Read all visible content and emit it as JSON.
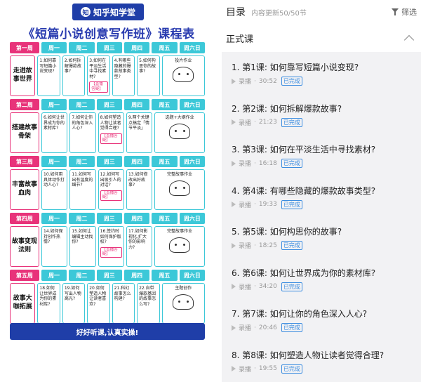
{
  "poster": {
    "brand": "知乎知学堂",
    "title": "《短篇小说创意写作班》课程表",
    "day_headers": [
      "周一",
      "周二",
      "周三",
      "周四",
      "周五",
      "周六日"
    ],
    "weeks": [
      {
        "week_label": "第一周",
        "topic": "走进故事世界",
        "days": [
          "1.如何靠写短篇小说变现?",
          "2.如何拆解爆款故事?",
          "3.如何在平淡生活中寻找素材?",
          "4.有哪些隐藏的爆款故事类型?",
          "5.如何构思你的故事?"
        ],
        "weekend": "投片作业",
        "badge_day": 2,
        "badge": "【直播答疑】"
      },
      {
        "week_label": "第二周",
        "topic": "搭建故事骨架",
        "days": [
          "6.如何让世界成为你的素材库?",
          "7.如何让你的角色深入人心?",
          "8.如何塑造人物让读者觉得合理?",
          "9.两个关键点搞定「情节平淡」",
          ""
        ],
        "weekend": "选题+大纲作业",
        "badge_day": 2,
        "badge": "【直播答疑】"
      },
      {
        "week_label": "第三周",
        "topic": "丰富故事血肉",
        "days": [
          "10.如何用具体动作打动人心?",
          "11.如何写出有温度的细节?",
          "12.如何写出吸引人的对话?",
          "13.如何修改出好故事?",
          ""
        ],
        "weekend": "完整故事作业",
        "badge_day": 2,
        "badge": "【直播答疑】"
      },
      {
        "week_label": "第四周",
        "topic": "故事变现法则",
        "days": [
          "14.如何保持创作热情?",
          "15.如何让编辑主动找你?",
          "16.签约时如何保护版权?",
          "17.如何影视化,扩大你的影响力?",
          ""
        ],
        "weekend": "完整故事作业",
        "badge_day": 2,
        "badge": "【直播答疑】"
      },
      {
        "week_label": "第五周",
        "topic": "故事大咖拓展",
        "days": [
          "18.如何让世界成为你的素材库?",
          "19.如何写出人物高光?",
          "20.如何塑造人物让读者喜欢?",
          "21.科幻故事怎么构建?",
          "22.自带爆款基因的故事怎么写?"
        ],
        "weekend": "主题创作",
        "badge_day": -1,
        "badge": ""
      }
    ],
    "footer": "好好听课,认真实操!"
  },
  "panel": {
    "toc_title": "目录",
    "update_info": "内容更新50/50节",
    "filter_label": "筛选",
    "section_title": "正式课",
    "lessons": [
      {
        "title": "1. 第1课: 如何靠写短篇小说变现?",
        "kind": "录播",
        "duration": "30:52",
        "status": "已完成"
      },
      {
        "title": "2. 第2课: 如何拆解爆款故事?",
        "kind": "录播",
        "duration": "21:23",
        "status": "已完成"
      },
      {
        "title": "3. 第3课: 如何在平淡生活中寻找素材?",
        "kind": "录播",
        "duration": "16:18",
        "status": "已完成"
      },
      {
        "title": "4. 第4课: 有哪些隐藏的爆款故事类型?",
        "kind": "录播",
        "duration": "19:33",
        "status": "已完成"
      },
      {
        "title": "5. 第5课: 如何构思你的故事?",
        "kind": "录播",
        "duration": "18:25",
        "status": "已完成"
      },
      {
        "title": "6. 第6课: 如何让世界成为你的素材库?",
        "kind": "录播",
        "duration": "34:20",
        "status": "已完成"
      },
      {
        "title": "7. 第7课: 如何让你的角色深入人心?",
        "kind": "录播",
        "duration": "20:46",
        "status": "已完成"
      },
      {
        "title": "8. 第8课: 如何塑造人物让读者觉得合理?",
        "kind": "录播",
        "duration": "19:55",
        "status": "已完成"
      }
    ]
  }
}
